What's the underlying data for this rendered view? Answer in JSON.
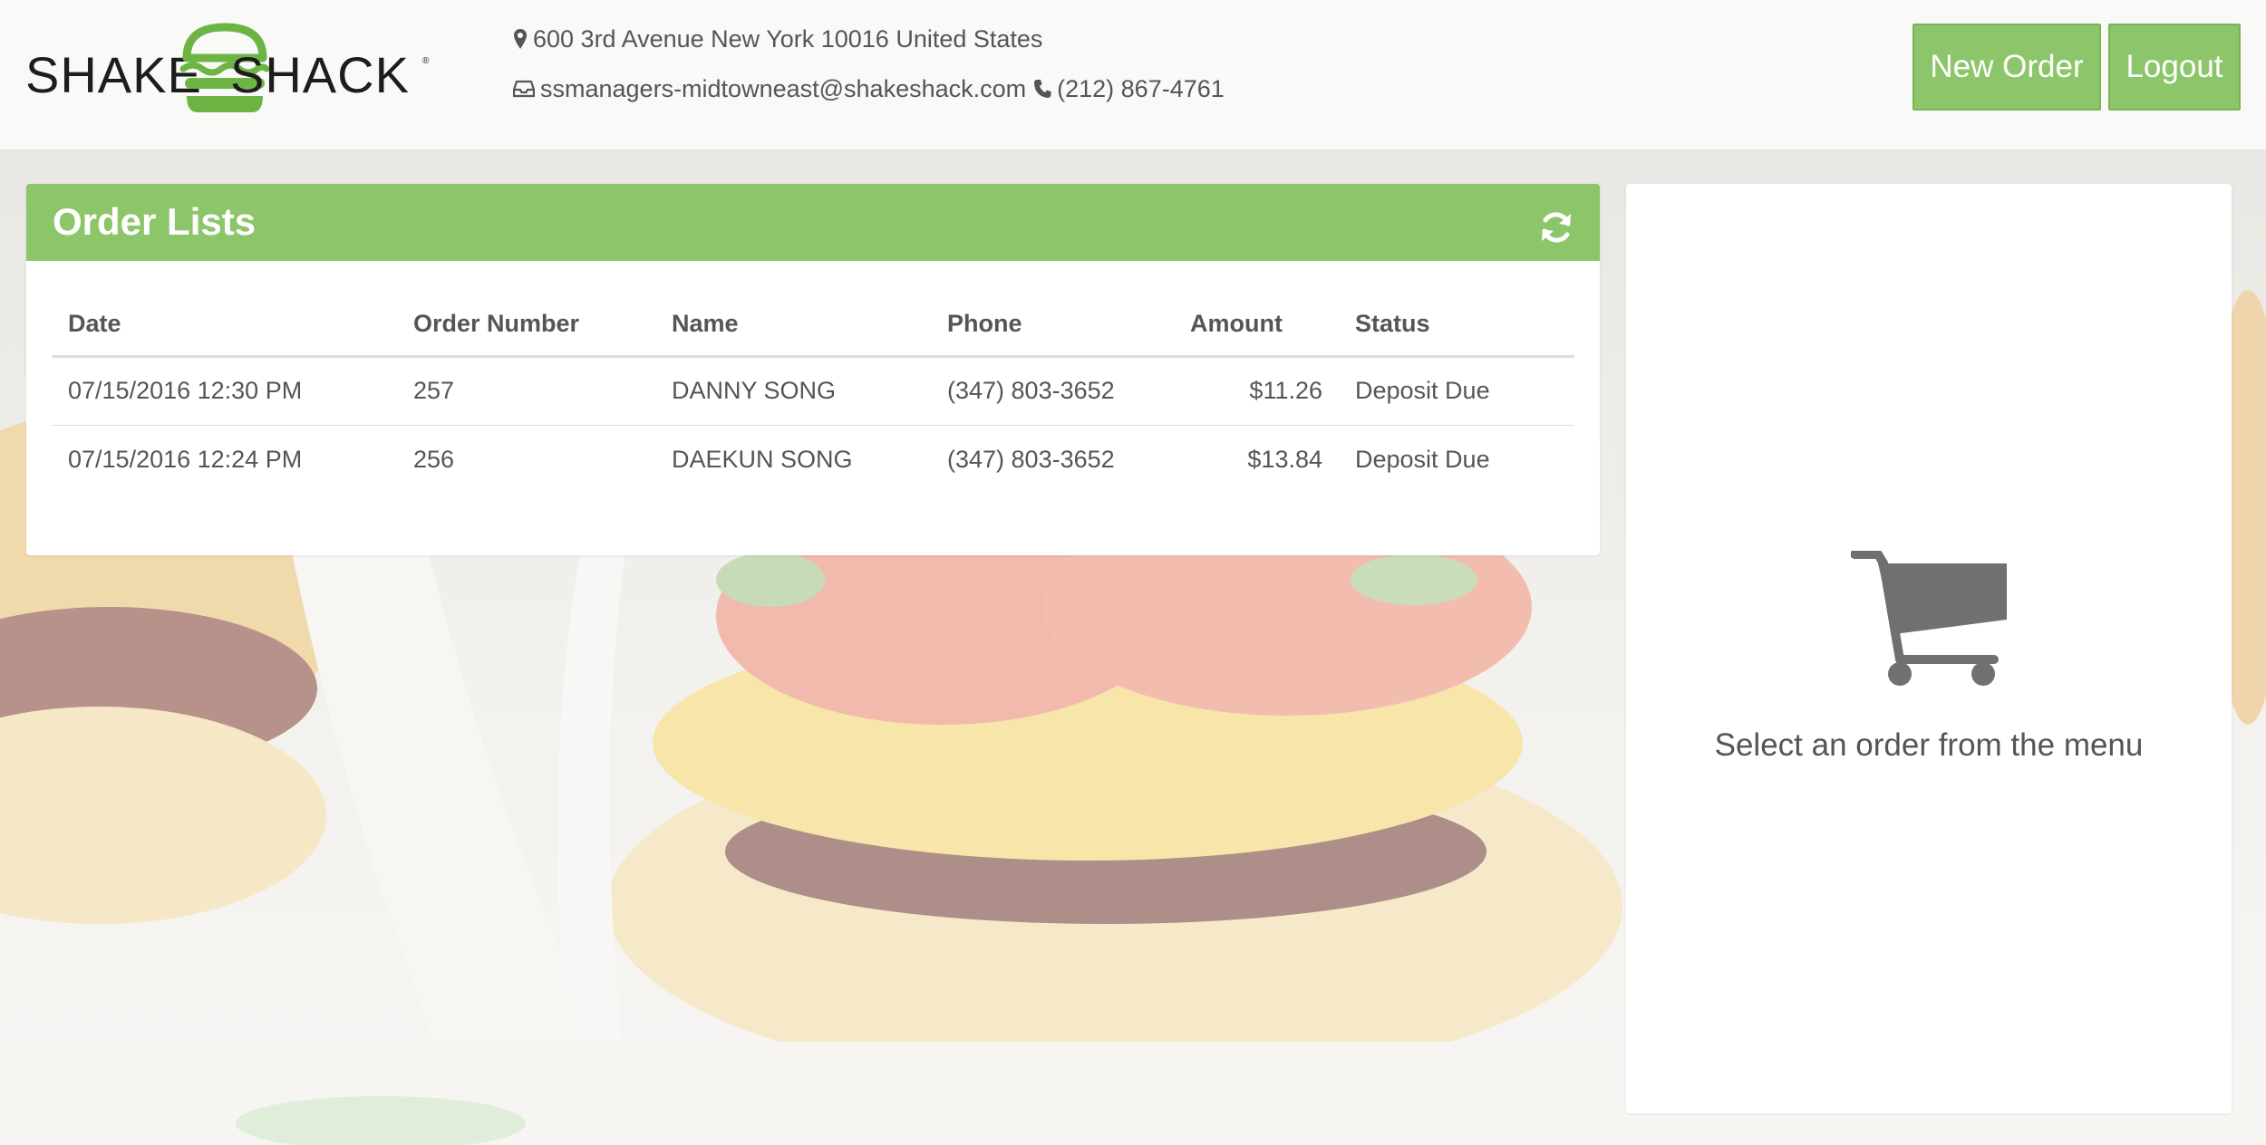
{
  "brand": {
    "name_left": "SHAKE",
    "name_right": "SHACK",
    "logo_icon": "burger-icon",
    "accent_color": "#8dc66a"
  },
  "store": {
    "address": "600 3rd Avenue New York 10016 United States",
    "email": "ssmanagers-midtowneast@shakeshack.com",
    "phone": "(212) 867-4761"
  },
  "actions": {
    "new_order": "New Order",
    "logout": "Logout"
  },
  "orders": {
    "title": "Order Lists",
    "refresh_icon": "refresh-icon",
    "columns": [
      "Date",
      "Order Number",
      "Name",
      "Phone",
      "Amount",
      "Status"
    ],
    "rows": [
      {
        "date": "07/15/2016 12:30 PM",
        "number": "257",
        "name": "DANNY SONG",
        "phone": "(347) 803-3652",
        "amount": "$11.26",
        "status": "Deposit Due"
      },
      {
        "date": "07/15/2016 12:24 PM",
        "number": "256",
        "name": "DAEKUN SONG",
        "phone": "(347) 803-3652",
        "amount": "$13.84",
        "status": "Deposit Due"
      }
    ]
  },
  "detail": {
    "empty_icon": "shopping-cart-icon",
    "empty_message": "Select an order from the menu"
  }
}
